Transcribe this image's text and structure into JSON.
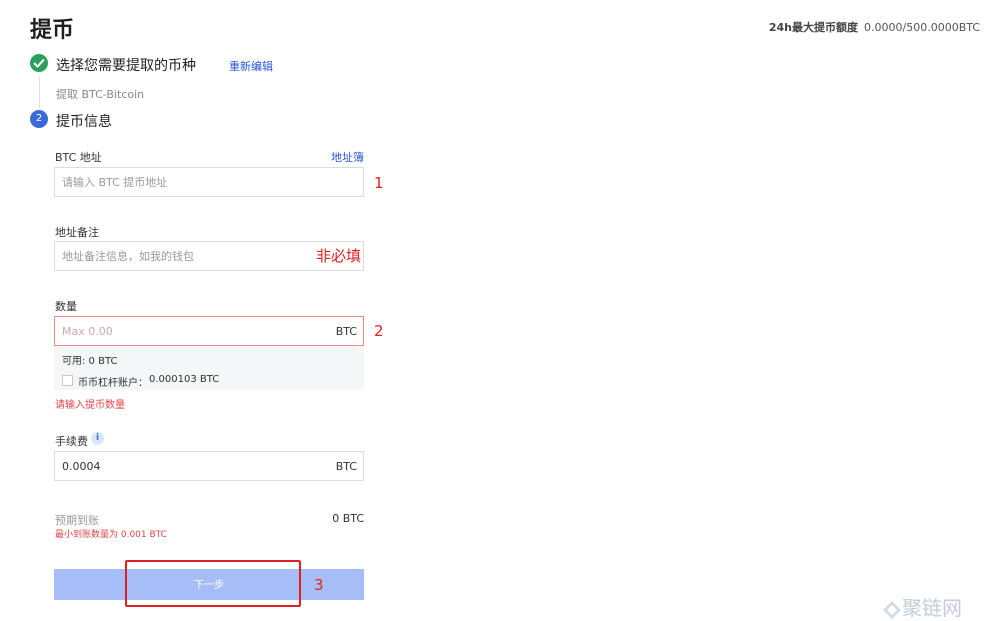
{
  "header": {
    "title": "提币",
    "limit_label": "24h最大提币额度",
    "limit_value": "0.0000/500.0000BTC"
  },
  "steps": {
    "step1": {
      "title": "选择您需要提取的币种",
      "reedit": "重新编辑",
      "subtitle": "提取 BTC-Bitcoin"
    },
    "step2": {
      "number": "2",
      "title": "提币信息"
    }
  },
  "address": {
    "label": "BTC 地址",
    "address_book": "地址簿",
    "placeholder": "请输入 BTC 提币地址",
    "annotation": "1"
  },
  "remark": {
    "label": "地址备注",
    "placeholder": "地址备注信息，如我的钱包",
    "annotation": "非必填"
  },
  "amount": {
    "label": "数量",
    "placeholder": "Max 0.00",
    "unit": "BTC",
    "annotation": "2",
    "available": "可用:  0 BTC",
    "margin_label": "币币杠杆账户：",
    "margin_value": "0.000103 BTC",
    "error": "请输入提币数量"
  },
  "fee": {
    "label": "手续费",
    "info_icon": "i",
    "value": "0.0004",
    "unit": "BTC"
  },
  "expected": {
    "label": "预期到账",
    "value": "0 BTC",
    "min_note": "最小到账数量为 0.001 BTC"
  },
  "next": {
    "label": "下一步",
    "annotation": "3"
  },
  "watermark": "聚链网",
  "colors": {
    "accent": "#3b6ad8",
    "success": "#2aa15a",
    "error": "#e04848",
    "button": "#a7bdf7",
    "annotation": "#e02020"
  }
}
